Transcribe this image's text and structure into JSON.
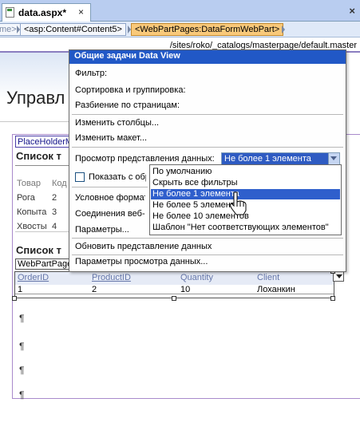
{
  "document_tab": {
    "title": "data.aspx*",
    "close_glyph": "×"
  },
  "window": {
    "close_glyph": "×"
  },
  "tag_selector": {
    "crumbs": [
      "me>",
      "<asp:Content#Content5>",
      "<WebPartPages:DataFormWebPart>"
    ]
  },
  "master_path": "/sites/roko/_catalogs/masterpage/default.master",
  "page": {
    "heading": "Управл",
    "placeholder_tab": "PlaceHolderM",
    "list_title_1": "Список т",
    "list_table": {
      "headers": [
        "Товар",
        "Код"
      ],
      "rows": [
        [
          "Рога",
          "2"
        ],
        [
          "Копыта",
          "3"
        ],
        [
          "Хвосты",
          "4"
        ]
      ]
    },
    "list_title_2": "Список т",
    "webpart_tab": "WebPartPage",
    "pilcrow": "¶"
  },
  "data_view": {
    "columns": [
      "OrderID",
      "ProductID",
      "Quantity",
      "Client"
    ],
    "row": [
      "1",
      "2",
      "10",
      "Лоханкин"
    ]
  },
  "tasks_panel": {
    "header": "Общие задачи Data View",
    "filter": "Фильтр:",
    "sort_group": "Сортировка и группировка:",
    "paging": "Разбиение по страницам:",
    "edit_columns": "Изменить столбцы...",
    "edit_layout": "Изменить макет...",
    "preview_label": "Просмотр представления данных:",
    "preview_selected": "Не более 1 элемента",
    "show_with_checkbox": "Показать с обр",
    "conditional_formatting": "Условное формати",
    "web_part_connections": "Соединения веб-ч",
    "parameters": "Параметры...",
    "refresh_view": "Обновить представление данных",
    "view_parameters": "Параметры просмотра данных..."
  },
  "preview_options": [
    "По умолчанию",
    "Скрыть все фильтры",
    "Не более 1 элемента",
    "Не более 5 элементов",
    "Не более 10 элементов",
    "Шаблон \"Нет соответствующих элементов\""
  ],
  "colors": {
    "accent_blue": "#2158c6",
    "selection_blue": "#2f5fcc",
    "tag_highlight": "#f9c97a"
  }
}
